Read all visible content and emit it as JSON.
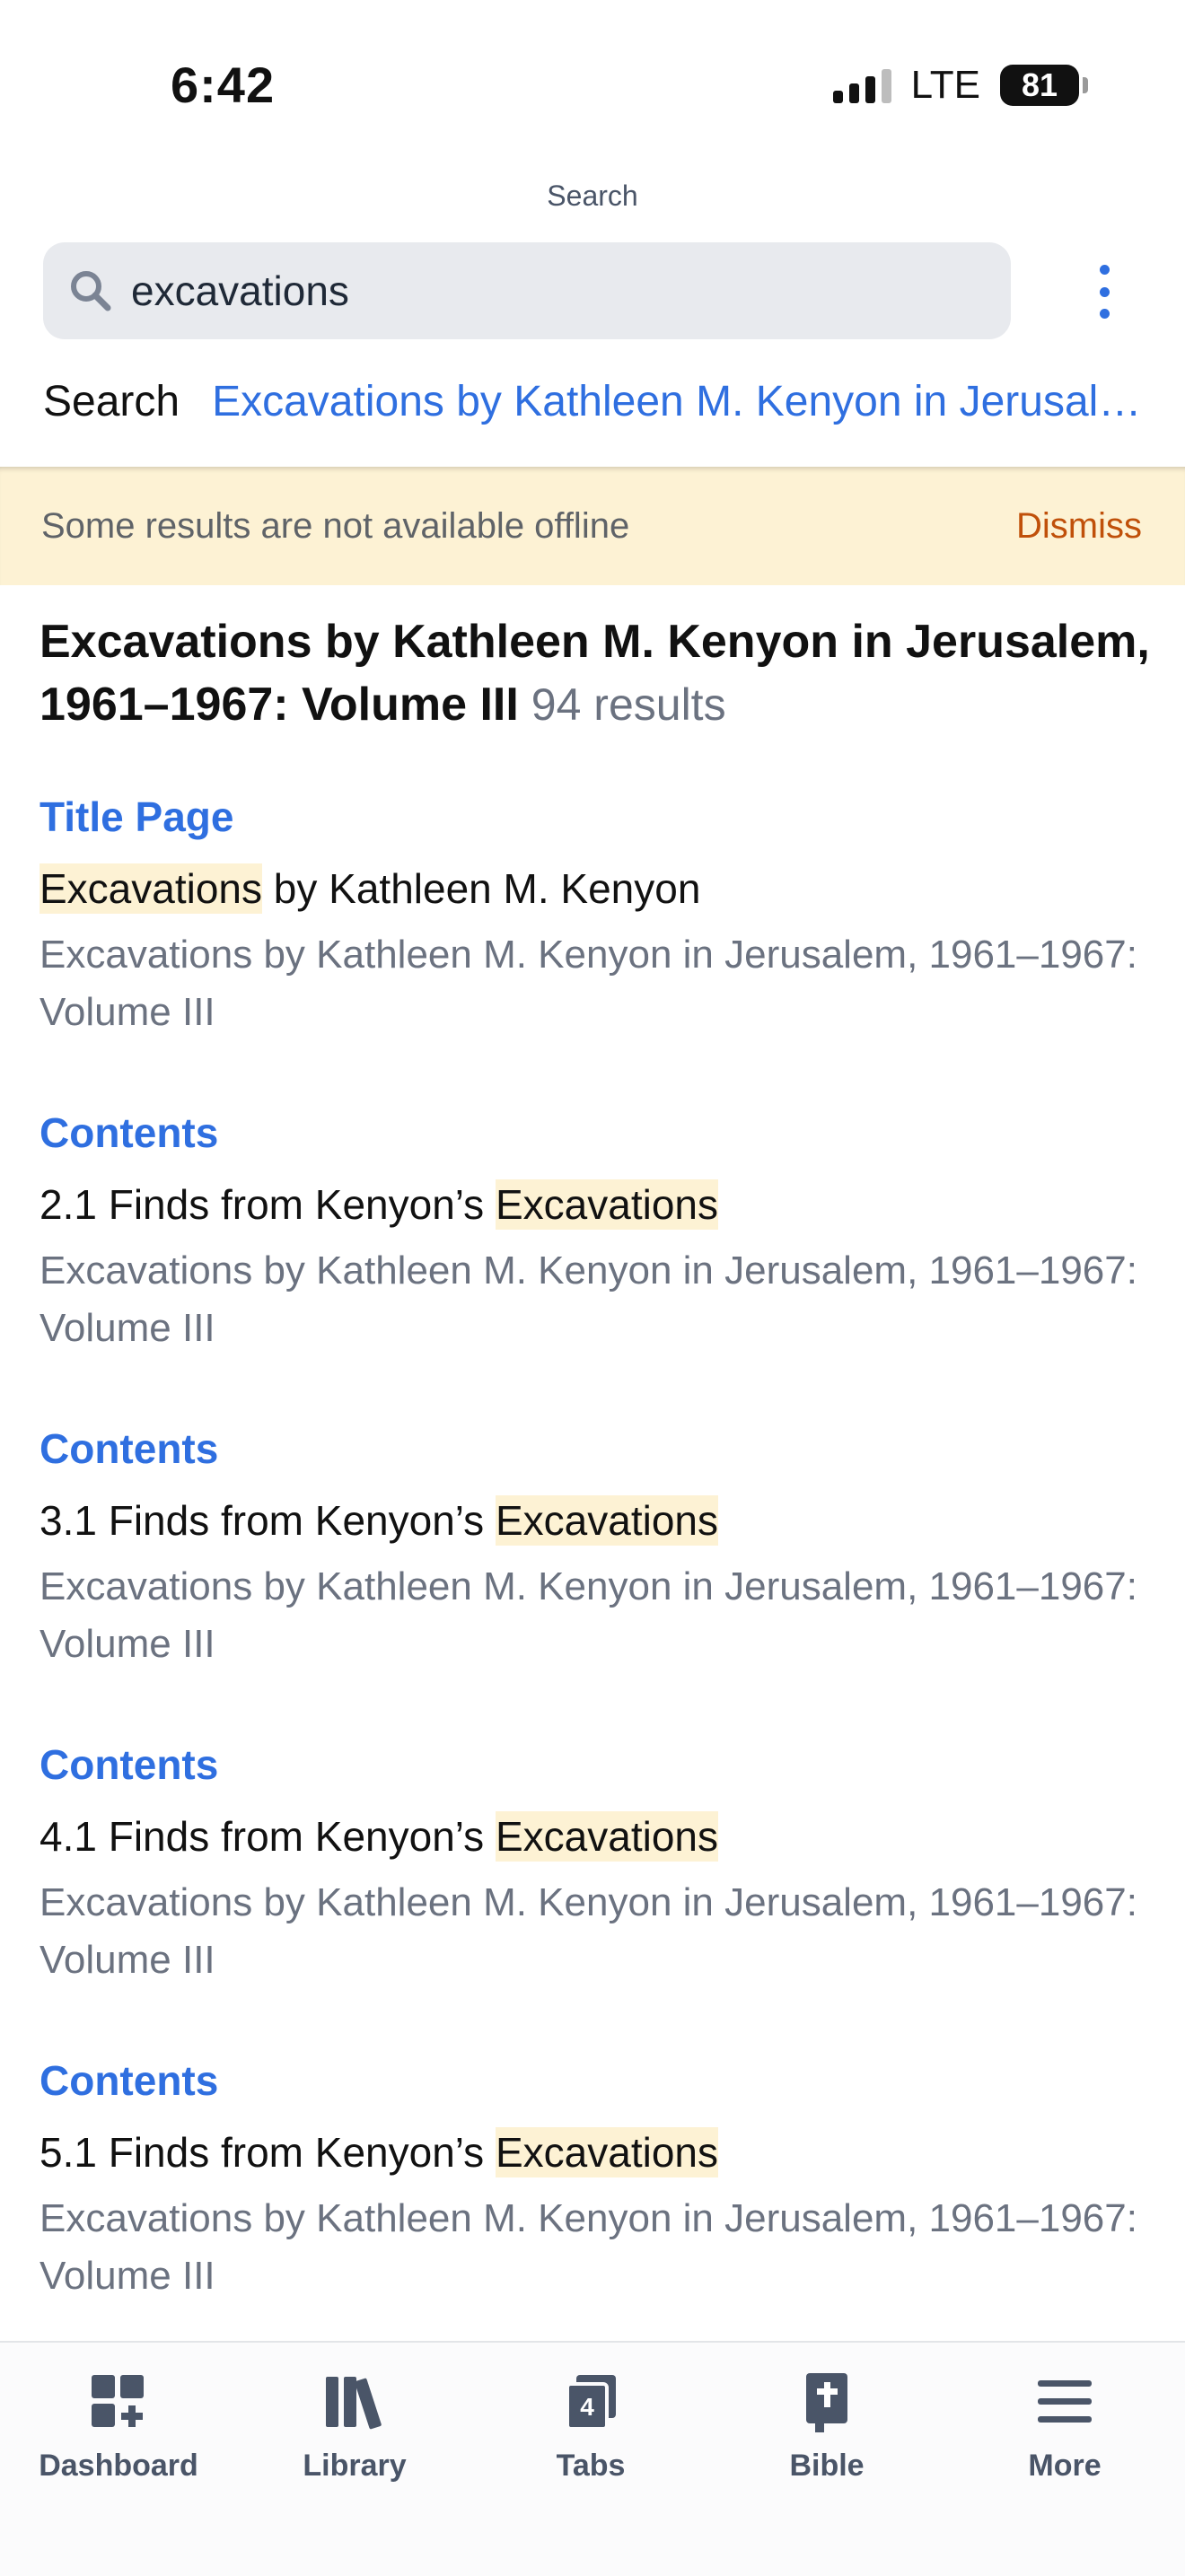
{
  "status_bar": {
    "time": "6:42",
    "network": "LTE",
    "battery": "81"
  },
  "nav": {
    "title": "Search"
  },
  "search": {
    "value": "excavations",
    "icon": "search-icon"
  },
  "scope": {
    "label": "Search",
    "link": "Excavations by Kathleen M. Kenyon in Jerusalem, 1961–1967: Volume III"
  },
  "banner": {
    "text": "Some results are not available offline",
    "dismiss": "Dismiss"
  },
  "book": {
    "title": "Excavations by Kathleen M. Kenyon in Jerusalem, 1961–1967: Volume III",
    "count": "94 results"
  },
  "results": [
    {
      "section": "Title Page",
      "title_pre": "",
      "title_hl": "Excavations",
      "title_post": " by Kathleen M. Kenyon",
      "source": "Excavations by Kathleen M. Kenyon in Jerusalem, 1961–1967: Volume III"
    },
    {
      "section": "Contents",
      "title_pre": "2.1 Finds from Kenyon’s ",
      "title_hl": "Excavations",
      "title_post": "",
      "source": "Excavations by Kathleen M. Kenyon in Jerusalem, 1961–1967: Volume III"
    },
    {
      "section": "Contents",
      "title_pre": "3.1 Finds from Kenyon’s ",
      "title_hl": "Excavations",
      "title_post": "",
      "source": "Excavations by Kathleen M. Kenyon in Jerusalem, 1961–1967: Volume III"
    },
    {
      "section": "Contents",
      "title_pre": "4.1 Finds from Kenyon’s ",
      "title_hl": "Excavations",
      "title_post": "",
      "source": "Excavations by Kathleen M. Kenyon in Jerusalem, 1961–1967: Volume III"
    },
    {
      "section": "Contents",
      "title_pre": "5.1 Finds from Kenyon’s ",
      "title_hl": "Excavations",
      "title_post": "",
      "source": "Excavations by Kathleen M. Kenyon in Jerusalem, 1961–1967: Volume III"
    }
  ],
  "tab_bar": [
    {
      "label": "Dashboard",
      "icon": "dashboard-icon"
    },
    {
      "label": "Library",
      "icon": "library-icon"
    },
    {
      "label": "Tabs",
      "icon": "tabs-icon",
      "badge": "4"
    },
    {
      "label": "Bible",
      "icon": "bible-icon"
    },
    {
      "label": "More",
      "icon": "menu-icon"
    }
  ],
  "colors": {
    "accent": "#2f6fe0",
    "highlight": "#fdf2d4",
    "dismiss": "#c0500a",
    "muted": "#6b7280"
  }
}
